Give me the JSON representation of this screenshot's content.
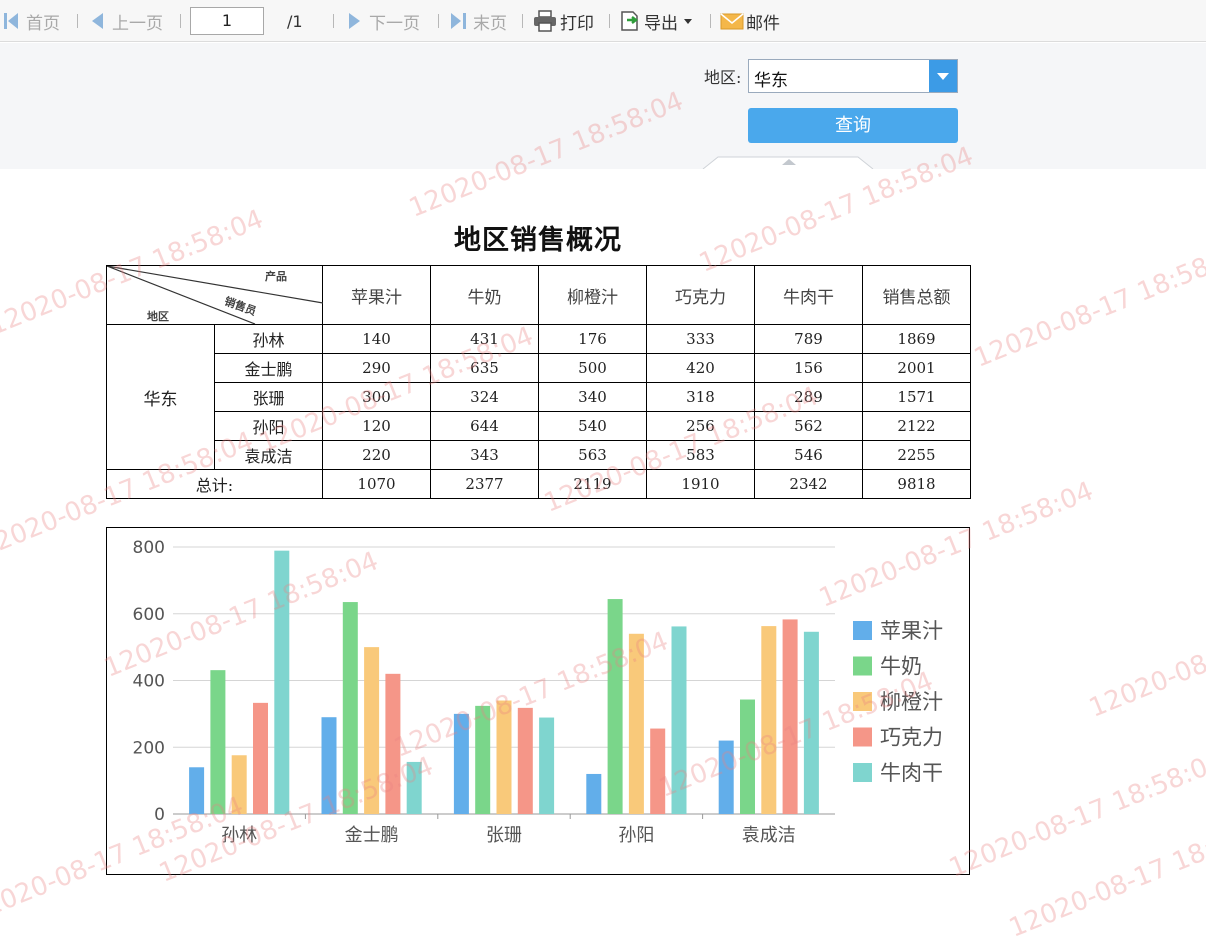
{
  "toolbar": {
    "first": "首页",
    "prev": "上一页",
    "page_value": "1",
    "page_total": "/1",
    "next": "下一页",
    "last": "末页",
    "print": "打印",
    "export": "导出",
    "mail": "邮件"
  },
  "params": {
    "region_label": "地区:",
    "region_value": "华东",
    "query_label": "查询"
  },
  "report": {
    "title": "地区销售概况",
    "header_corner": {
      "product": "产品",
      "salesperson": "销售员",
      "region": "地区"
    },
    "columns": [
      "苹果汁",
      "牛奶",
      "柳橙汁",
      "巧克力",
      "牛肉干",
      "销售总额"
    ],
    "region": "华东",
    "rows": [
      {
        "name": "孙林",
        "values": [
          "140",
          "431",
          "176",
          "333",
          "789",
          "1869"
        ]
      },
      {
        "name": "金士鹏",
        "values": [
          "290",
          "635",
          "500",
          "420",
          "156",
          "2001"
        ]
      },
      {
        "name": "张珊",
        "values": [
          "300",
          "324",
          "340",
          "318",
          "289",
          "1571"
        ]
      },
      {
        "name": "孙阳",
        "values": [
          "120",
          "644",
          "540",
          "256",
          "562",
          "2122"
        ]
      },
      {
        "name": "袁成洁",
        "values": [
          "220",
          "343",
          "563",
          "583",
          "546",
          "2255"
        ]
      }
    ],
    "total_label": "总计:",
    "totals": [
      "1070",
      "2377",
      "2119",
      "1910",
      "2342",
      "9818"
    ]
  },
  "chart_data": {
    "type": "bar",
    "categories": [
      "孙林",
      "金士鹏",
      "张珊",
      "孙阳",
      "袁成洁"
    ],
    "series": [
      {
        "name": "苹果汁",
        "color": "#62aeea",
        "values": [
          140,
          290,
          300,
          120,
          220
        ]
      },
      {
        "name": "牛奶",
        "color": "#7ad68a",
        "values": [
          431,
          635,
          324,
          644,
          343
        ]
      },
      {
        "name": "柳橙汁",
        "color": "#f9c97a",
        "values": [
          176,
          500,
          340,
          540,
          563
        ]
      },
      {
        "name": "巧克力",
        "color": "#f59688",
        "values": [
          333,
          420,
          318,
          256,
          583
        ]
      },
      {
        "name": "牛肉干",
        "color": "#7fd5cf",
        "values": [
          789,
          156,
          289,
          562,
          546
        ]
      }
    ],
    "yticks": [
      "0",
      "200",
      "400",
      "600",
      "800"
    ],
    "ylim": [
      0,
      800
    ],
    "grid": true,
    "legend": "right"
  },
  "watermark": "12020-08-17 18:58:04"
}
